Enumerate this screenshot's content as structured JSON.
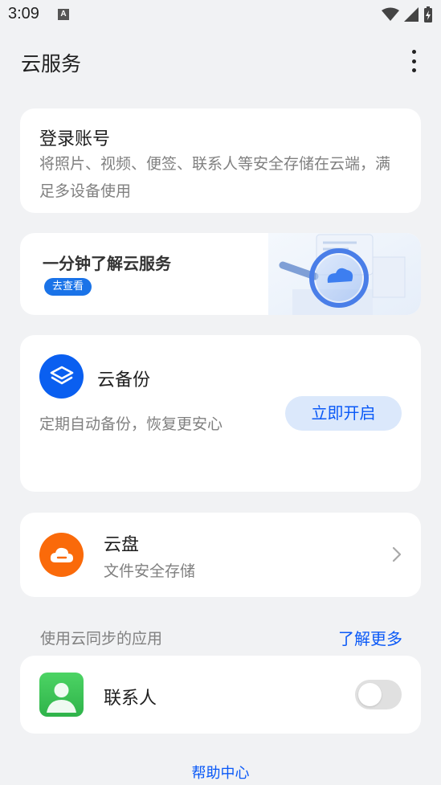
{
  "status_bar": {
    "time": "3:09",
    "notification_letter": "A"
  },
  "app_bar": {
    "title": "云服务"
  },
  "login": {
    "title": "登录账号",
    "description": "将照片、视频、便签、联系人等安全存储在云端，满足多设备使用"
  },
  "banner": {
    "title": "一分钟了解云服务",
    "tag": "去查看"
  },
  "backup": {
    "title": "云备份",
    "description": "定期自动备份，恢复更安心",
    "button": "立即开启"
  },
  "drive": {
    "title": "云盘",
    "description": "文件安全存储"
  },
  "sync_section": {
    "label": "使用云同步的应用",
    "link": "了解更多"
  },
  "contacts": {
    "title": "联系人",
    "sync_enabled": false
  },
  "footer": {
    "help": "帮助中心"
  },
  "colors": {
    "accent": "#0a59f7",
    "backup_icon": "#0a5ff0",
    "drive_icon": "#fa6a0a",
    "contacts_icon": "#3cc456",
    "background": "#f1f2f4"
  },
  "icons": {
    "backup": "layers-icon",
    "drive": "cloud-icon",
    "contacts": "person-icon"
  }
}
